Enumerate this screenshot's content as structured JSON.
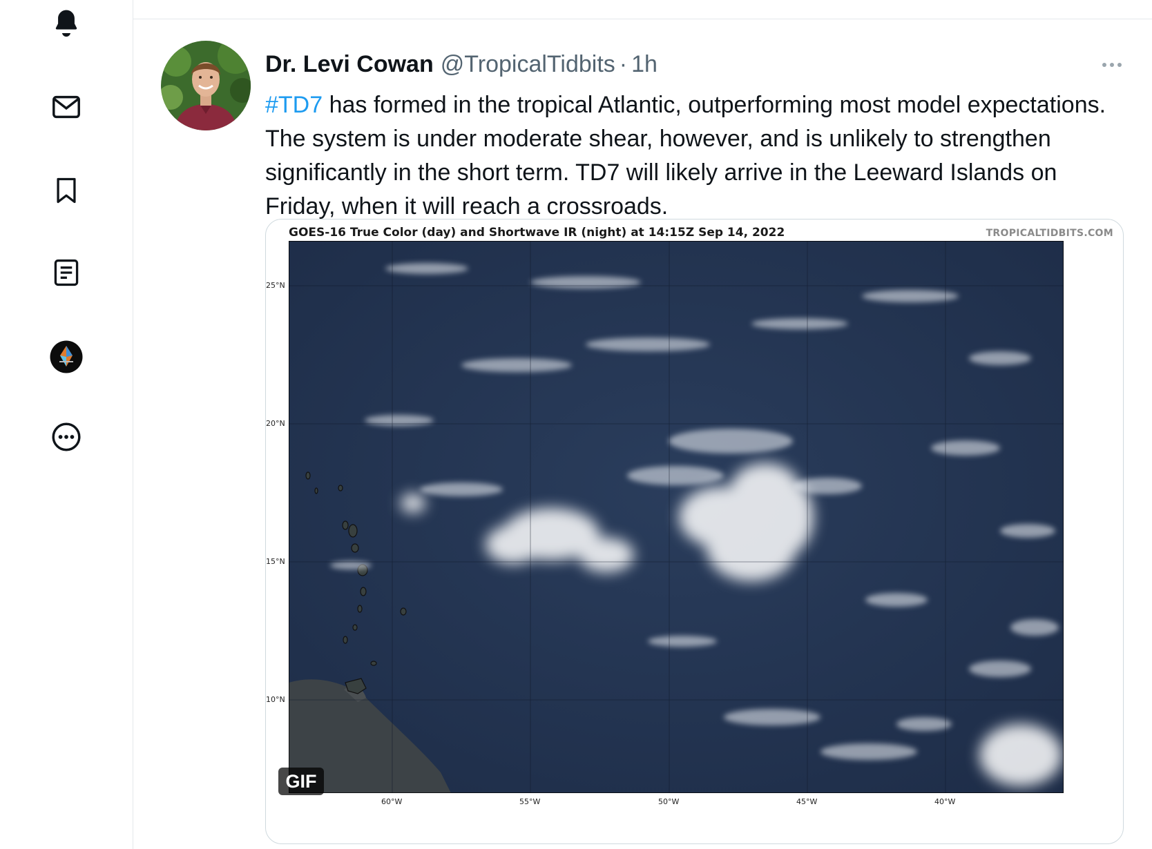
{
  "nav": {
    "items": [
      {
        "name": "notifications",
        "icon": "bell-icon"
      },
      {
        "name": "messages",
        "icon": "envelope-icon"
      },
      {
        "name": "bookmarks",
        "icon": "bookmark-icon"
      },
      {
        "name": "lists",
        "icon": "list-icon"
      },
      {
        "name": "profile",
        "icon": "profile-avatar-icon"
      },
      {
        "name": "more",
        "icon": "more-circle-icon"
      }
    ]
  },
  "tweet": {
    "display_name": "Dr. Levi Cowan",
    "handle": "@TropicalTidbits",
    "separator": "·",
    "time": "1h",
    "hashtag": "#TD7",
    "text": " has formed in the tropical Atlantic, outperforming most model expectations. The system is under moderate shear, however, and is unlikely to strengthen significantly in the short term. TD7 will likely arrive in the Leeward Islands on Friday, when it will reach a crossroads.",
    "media": {
      "title": "GOES-16 True Color (day) and Shortwave IR (night) at 14:15Z Sep 14, 2022",
      "credit": "TROPICALTIDBITS.COM",
      "lat_labels": [
        "25°N",
        "20°N",
        "15°N",
        "10°N"
      ],
      "lon_labels": [
        "60°W",
        "55°W",
        "50°W",
        "45°W",
        "40°W"
      ],
      "badge": "GIF"
    }
  },
  "colors": {
    "accent": "#1d9bf0",
    "secondary_text": "#536471",
    "ocean": "#243654",
    "divider": "#e4e8eb"
  }
}
